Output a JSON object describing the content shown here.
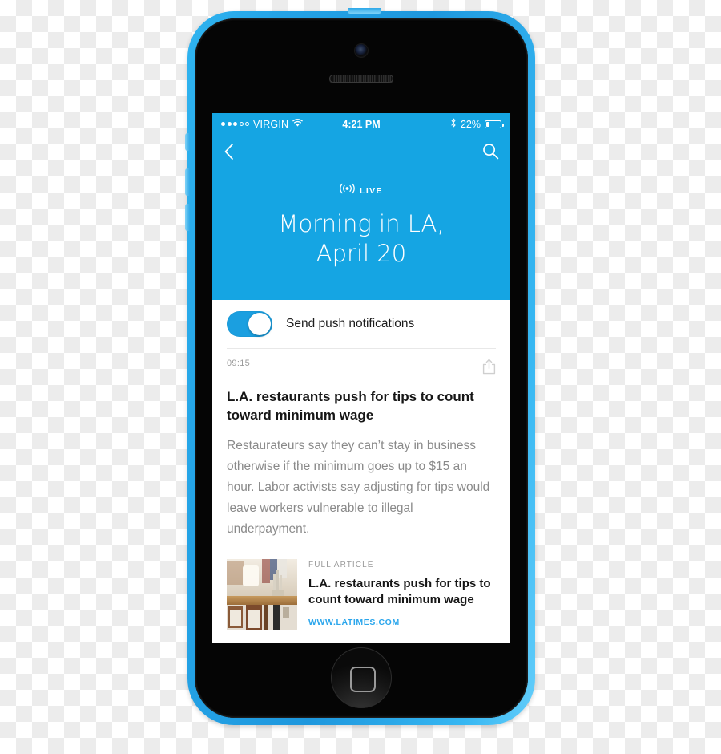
{
  "device": {
    "name": "iPhone 5c",
    "body_color": "#2aa8e8",
    "screen_background": "#ffffff"
  },
  "status_bar": {
    "signal_dots_filled": 3,
    "signal_dots_total": 5,
    "carrier": "VIRGIN",
    "wifi_icon": "wifi-icon",
    "time": "4:21 PM",
    "bluetooth_icon": "bluetooth-icon",
    "battery_percent": "22%",
    "battery_level": 22
  },
  "nav_bar": {
    "back_icon": "chevron-left-icon",
    "search_icon": "search-icon"
  },
  "hero": {
    "live_icon": "broadcast-icon",
    "live_label": "LIVE",
    "title_line_1": "Morning in LA,",
    "title_line_2": "April 20",
    "background_color": "#15a5e3"
  },
  "settings": {
    "push_toggle_label": "Send push notifications",
    "push_toggle_on": true,
    "toggle_color": "#1b9fe0"
  },
  "post": {
    "time": "09:15",
    "share_icon": "share-icon",
    "headline": "L.A. restaurants push for tips to count toward minimum wage",
    "body": "Restaurateurs say they can’t stay in business otherwise if the minimum goes up to $15 an hour. Labor activists say adjusting for tips would leave workers vulnerable to illegal underpayment."
  },
  "article_card": {
    "thumbnail_alt": "restaurant-interior-thumbnail",
    "kicker": "FULL ARTICLE",
    "title": "L.A. restaurants push for tips to count toward minimum wage",
    "source": "WWW.LATIMES.COM",
    "source_color": "#2ba6ec"
  }
}
